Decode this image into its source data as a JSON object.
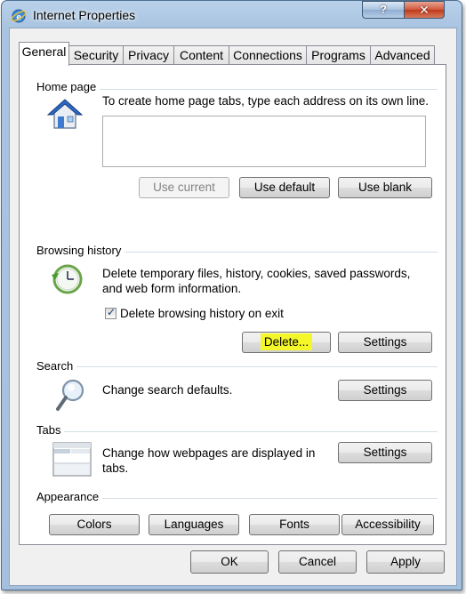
{
  "window": {
    "title": "Internet Properties",
    "help_label": "?",
    "close_label": "X"
  },
  "tabs": [
    "General",
    "Security",
    "Privacy",
    "Content",
    "Connections",
    "Programs",
    "Advanced"
  ],
  "active_tab": "General",
  "home_page": {
    "heading": "Home page",
    "description": "To create home page tabs, type each address on its own line.",
    "textarea_value": "",
    "use_current_label": "Use current",
    "use_default_label": "Use default",
    "use_blank_label": "Use blank"
  },
  "browsing_history": {
    "heading": "Browsing history",
    "description_line1": "Delete temporary files, history, cookies, saved passwords,",
    "description_line2": "and web form information.",
    "delete_on_exit_label": "Delete browsing history on exit",
    "delete_on_exit_checked": true,
    "delete_label": "Delete...",
    "settings_label": "Settings"
  },
  "search": {
    "heading": "Search",
    "description": "Change search defaults.",
    "settings_label": "Settings"
  },
  "tabs_section": {
    "heading": "Tabs",
    "description_line1": "Change how webpages are displayed in",
    "description_line2": "tabs.",
    "settings_label": "Settings"
  },
  "appearance": {
    "heading": "Appearance",
    "colors_label": "Colors",
    "languages_label": "Languages",
    "fonts_label": "Fonts",
    "accessibility_label": "Accessibility"
  },
  "footer": {
    "ok_label": "OK",
    "cancel_label": "Cancel",
    "apply_label": "Apply"
  },
  "colors": {
    "highlight": "#f4f72a",
    "title_bar": "#b9d1ea",
    "close_button": "#c0391b"
  },
  "icons": {
    "app": "ie-globe-icon",
    "home": "house-icon",
    "history": "clock-arrow-icon",
    "search": "magnifier-icon",
    "tabs": "tabs-window-icon"
  }
}
